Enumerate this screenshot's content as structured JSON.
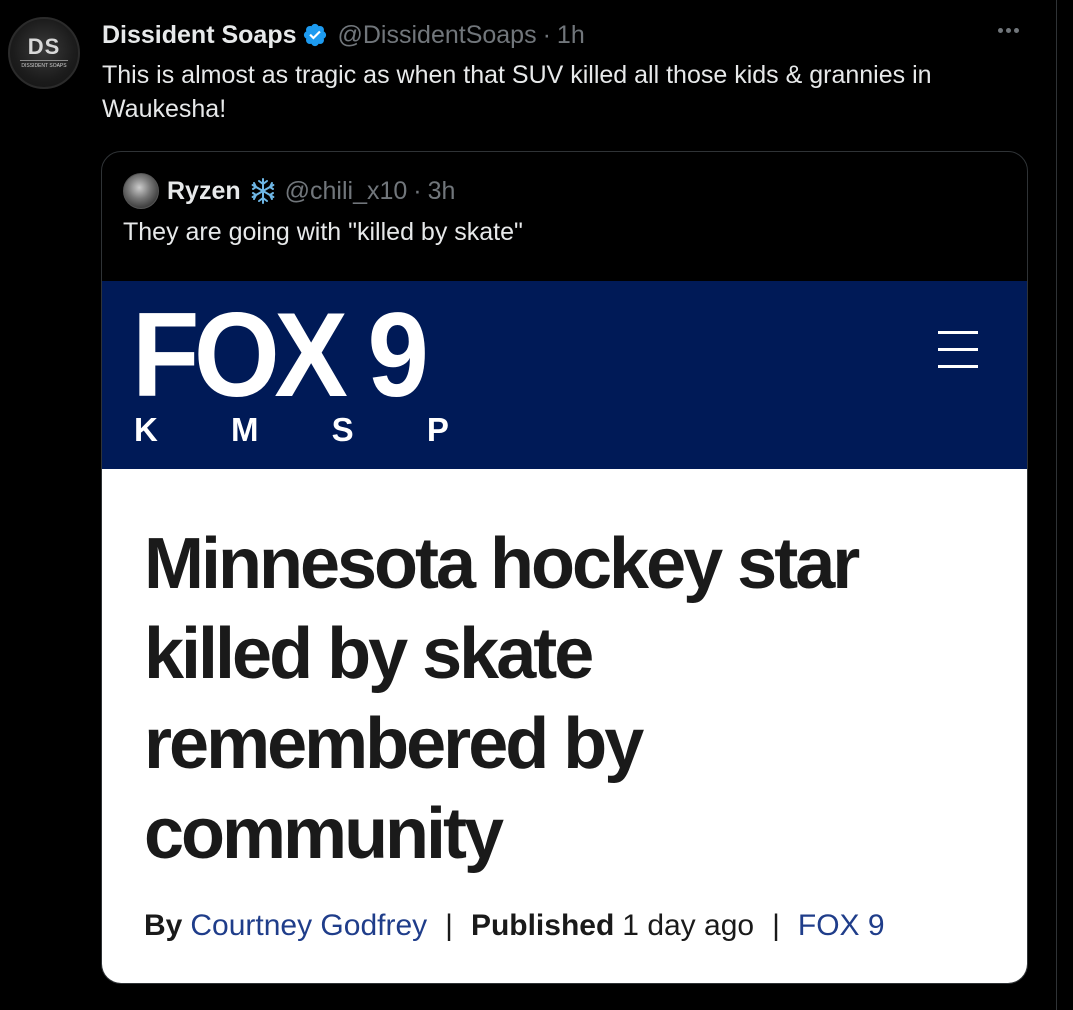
{
  "tweet": {
    "avatar_text": "DS",
    "avatar_subtext": "DISSIDENT SOAPS",
    "display_name": "Dissident Soaps",
    "handle": "@DissidentSoaps",
    "separator": "·",
    "time": "1h",
    "text": "This is almost as tragic as when that SUV killed all those kids & grannies in Waukesha!",
    "verified_color": "#1d9bf0"
  },
  "quote": {
    "display_name": "Ryzen",
    "handle": "@chili_x10",
    "separator": "·",
    "time": "3h",
    "text": "They are going with \"killed by skate\""
  },
  "article": {
    "logo_text": "FOX 9",
    "logo_subtext": "K M S P",
    "headline": "Minnesota hockey star killed by skate remembered by community",
    "by_label": "By",
    "author": "Courtney Godfrey",
    "published_label": "Published",
    "published_time": "1 day ago",
    "source": "FOX 9",
    "divider": "|",
    "brand_color": "#001a57"
  }
}
